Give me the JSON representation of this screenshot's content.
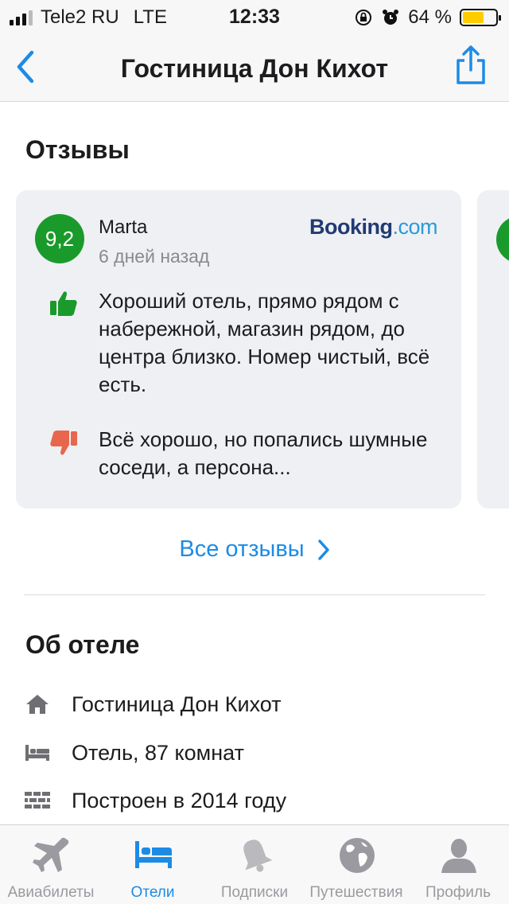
{
  "status_bar": {
    "carrier": "Tele2 RU",
    "network": "LTE",
    "time": "12:33",
    "battery": "64 %",
    "battery_level": 0.64
  },
  "nav": {
    "title": "Гостиница Дон Кихот",
    "back_icon": "chevron-left-icon",
    "share_icon": "share-icon"
  },
  "reviews": {
    "heading": "Отзывы",
    "card": {
      "score": "9,2",
      "author": "Marta",
      "date": "6 дней назад",
      "source_brand_part1": "Booking",
      "source_brand_part2": ".com",
      "positive": "Хороший отель, прямо рядом с набережной, магазин рядом, до центра близко. Номер чистый, всё есть.",
      "negative": "Всё хорошо, но попались шумные соседи, а персона..."
    },
    "all_reviews_link": "Все отзывы"
  },
  "about": {
    "heading": "Об отеле",
    "rows": [
      {
        "icon": "home-icon",
        "text": "Гостиница Дон Кихот"
      },
      {
        "icon": "bed-icon",
        "text": "Отель, 87 комнат"
      },
      {
        "icon": "brick-wall-icon",
        "text": "Построен в 2014 году"
      }
    ]
  },
  "tabs": [
    {
      "label": "Авиабилеты",
      "icon": "airplane-icon",
      "active": false
    },
    {
      "label": "Отели",
      "icon": "bed-icon",
      "active": true
    },
    {
      "label": "Подписки",
      "icon": "bell-icon",
      "active": false
    },
    {
      "label": "Путешествия",
      "icon": "globe-icon",
      "active": false
    },
    {
      "label": "Профиль",
      "icon": "person-icon",
      "active": false
    }
  ],
  "colors": {
    "accent": "#1d8be5",
    "score_green": "#1a9a2a",
    "thumb_up": "#1a9a2a",
    "thumb_down": "#e8664b",
    "card_bg": "#eff0f4"
  }
}
